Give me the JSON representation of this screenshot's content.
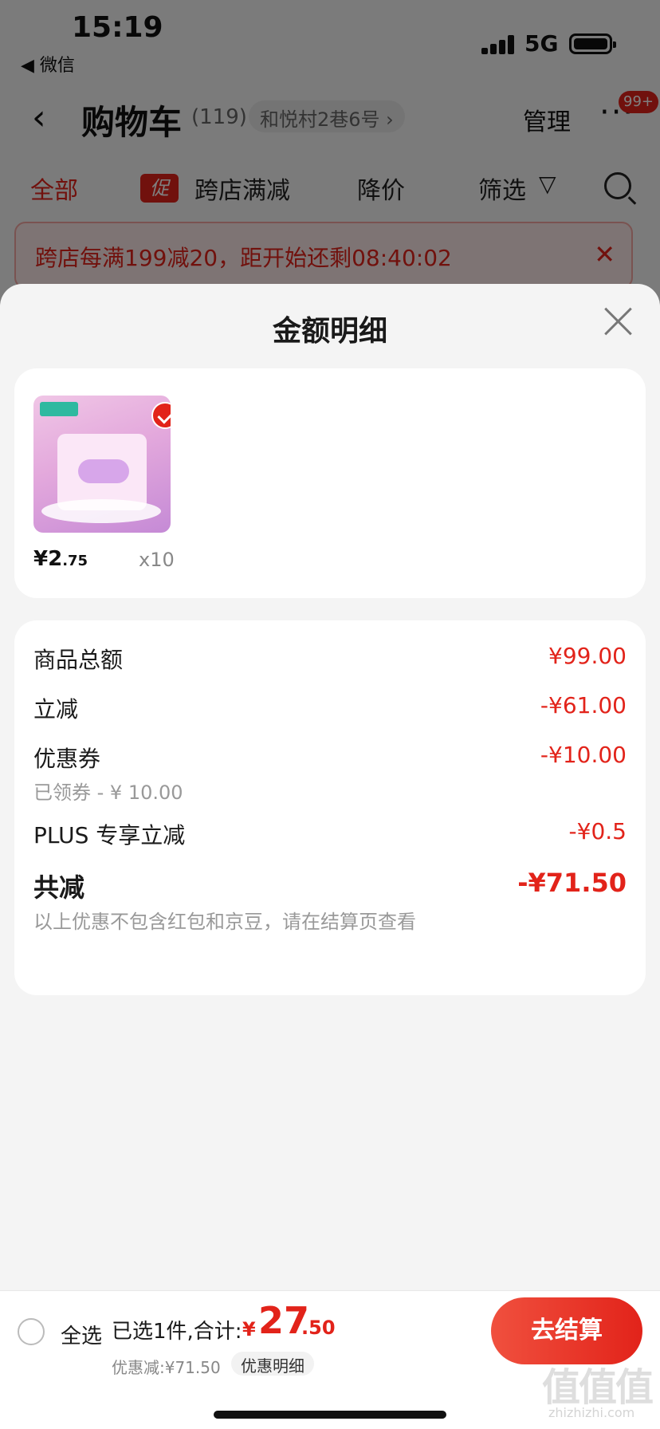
{
  "status_bar": {
    "time": "15:19",
    "back_app": "◀ 微信",
    "network": "5G"
  },
  "header": {
    "back_icon": "chevron-left-icon",
    "title": "购物车",
    "count": "(119)",
    "address": "和悦村2巷6号 ›",
    "manage": "管理",
    "more": "···",
    "badge": "99+"
  },
  "filters": {
    "all": "全部",
    "promo_tag": "促",
    "cross_store": "跨店满减",
    "price_drop": "降价",
    "filter": "筛选"
  },
  "promo_banner": {
    "text": "跨店每满199减20，距开始还剩08:40:02"
  },
  "sheet": {
    "title": "金额明细",
    "goods": [
      {
        "price_int": "¥2",
        "price_dec": ".75",
        "qty": "x10"
      }
    ],
    "detail": {
      "total_goods_label": "商品总额",
      "total_goods_value": "¥99.00",
      "instant_label": "立减",
      "instant_value": "-¥61.00",
      "coupon_label": "优惠券",
      "coupon_value": "-¥10.00",
      "coupon_sub": "已领券 - ¥ 10.00",
      "plus_label": "PLUS 专享立减",
      "plus_value": "-¥0.5",
      "sum_label": "共减",
      "sum_value": "-¥71.50",
      "sum_note": "以上优惠不包含红包和京豆，请在结算页查看"
    }
  },
  "bottom_bar": {
    "select_all": "全选",
    "summary": "已选1件,合计:",
    "currency": "¥",
    "total_int": "27",
    "total_dec": ".50",
    "discount": "优惠减:¥71.50",
    "discount_link": "优惠明细",
    "checkout": "去结算"
  },
  "watermark": {
    "text": "值值值",
    "url": "zhizhizhi.com"
  },
  "colors": {
    "accent": "#e2231a",
    "overlay": "rgba(0,0,0,0.5)"
  }
}
